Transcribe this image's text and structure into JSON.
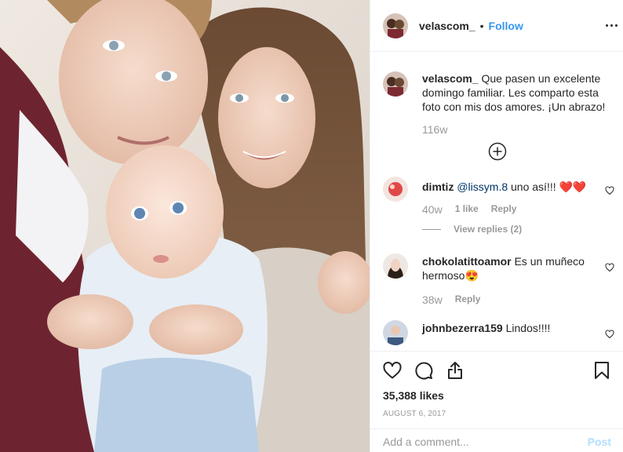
{
  "photo": {
    "description_icon": "family-photo"
  },
  "header": {
    "username": "velascom_",
    "separator": "•",
    "follow_label": "Follow",
    "more_icon": "more-dots-icon"
  },
  "caption": {
    "username": "velascom_",
    "text": "Que pasen un excelente domingo familiar. Les comparto esta foto con mis dos amores. ¡Un abrazo!",
    "time": "116w"
  },
  "load_more_icon": "plus-circle-icon",
  "comments": [
    {
      "username": "dimtiz",
      "mention": "@lissym.8",
      "text": " uno así!!! ❤️❤️",
      "time": "40w",
      "likes": "1 like",
      "reply": "Reply",
      "view_replies": "View replies (2)"
    },
    {
      "username": "chokolatittoamor",
      "text": "Es un muñeco hermoso😍",
      "time": "38w",
      "reply": "Reply"
    },
    {
      "username": "johnbezerra159",
      "text": "Lindos!!!!"
    }
  ],
  "actions": {
    "like_icon": "heart-icon",
    "comment_icon": "comment-icon",
    "share_icon": "share-icon",
    "save_icon": "bookmark-icon",
    "likes_count": "35,388 likes",
    "date": "AUGUST 6, 2017"
  },
  "add_comment": {
    "placeholder": "Add a comment...",
    "post_label": "Post"
  },
  "colors": {
    "accent": "#3897f0",
    "text": "#262626",
    "muted": "#999999",
    "post_disabled": "#b2dffc"
  }
}
